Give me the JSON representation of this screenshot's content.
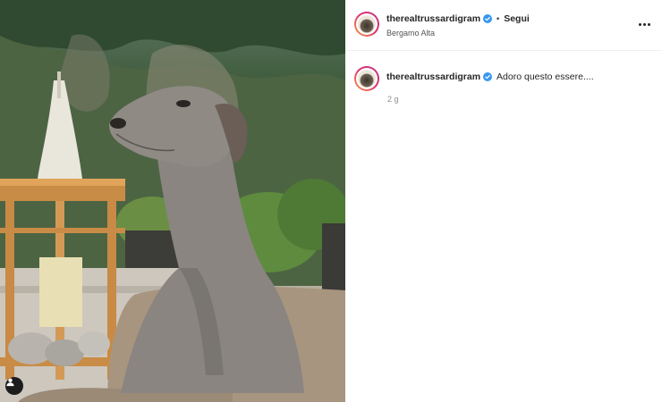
{
  "post": {
    "username": "therealtrussardigram",
    "verified": true,
    "separator": "•",
    "follow_label": "Segui",
    "location": "Bergamo Alta",
    "caption": "Adoro questo essere....",
    "time_ago": "2 g"
  },
  "colors": {
    "verified_blue": "#3897f0",
    "text_primary": "#262626",
    "text_secondary": "#8e8e8e"
  },
  "icons": {
    "more": "more-options-icon",
    "verified": "verified-badge-icon",
    "user_tag": "user-tag-icon"
  }
}
